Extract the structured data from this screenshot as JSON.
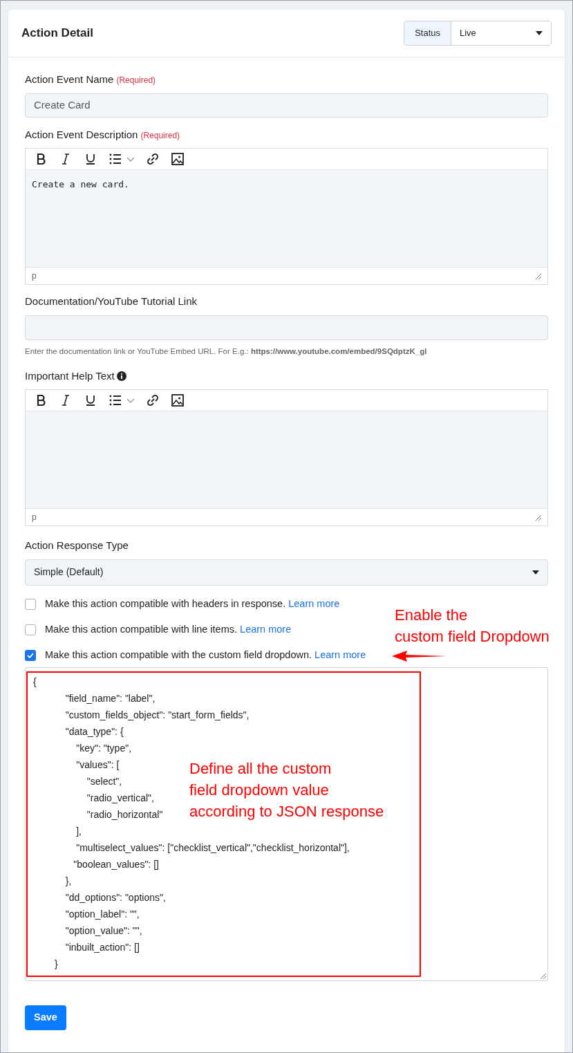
{
  "header": {
    "title": "Action Detail",
    "status_label": "Status",
    "status_value": "Live"
  },
  "event_name": {
    "label": "Action Event Name",
    "required": "(Required)",
    "value": "Create Card"
  },
  "event_description": {
    "label": "Action Event Description",
    "required": "(Required)",
    "content": "Create a new card.",
    "path": "p"
  },
  "documentation": {
    "label": "Documentation/YouTube Tutorial Link",
    "help": "Enter the documentation link or YouTube Embed URL. For E.g.: **https://www.youtube.com/embed/9SQdptzK_gl**"
  },
  "help_text": {
    "label": "Important Help Text",
    "path": "p"
  },
  "response_type": {
    "label": "Action Response Type",
    "value": "Simple (Default)"
  },
  "options": [
    {
      "text": "Make this action compatible with headers in response.",
      "link": "Learn more",
      "checked": false
    },
    {
      "text": "Make this action compatible with line items.",
      "link": "Learn more",
      "checked": false
    },
    {
      "text": "Make this action compatible with the custom field dropdown.",
      "link": "Learn more",
      "checked": true
    }
  ],
  "code_lines": [
    "{",
    "            \"field_name\": \"label\",",
    "            \"custom_fields_object\": \"start_form_fields\",",
    "            \"data_type\": {",
    "                \"key\": \"type\",",
    "                \"values\": [",
    "                    \"select\",",
    "                    \"radio_vertical\",",
    "                    \"radio_horizontal\"",
    "                ],",
    "                \"multiselect_values\": [\"checklist_vertical\",\"checklist_horizontal\"],",
    "               \"boolean_values\": []",
    "            },",
    "            \"dd_options\": \"options\",",
    "            \"option_label\": \"\",",
    "            \"option_value\": \"\",",
    "            \"inbuilt_action\": []",
    "        }"
  ],
  "annotations": {
    "enable_note": "Enable the\ncustom field Dropdown",
    "define_note": "Define all the custom\nfield dropdown value\naccording to JSON response"
  },
  "save_button": "Save"
}
